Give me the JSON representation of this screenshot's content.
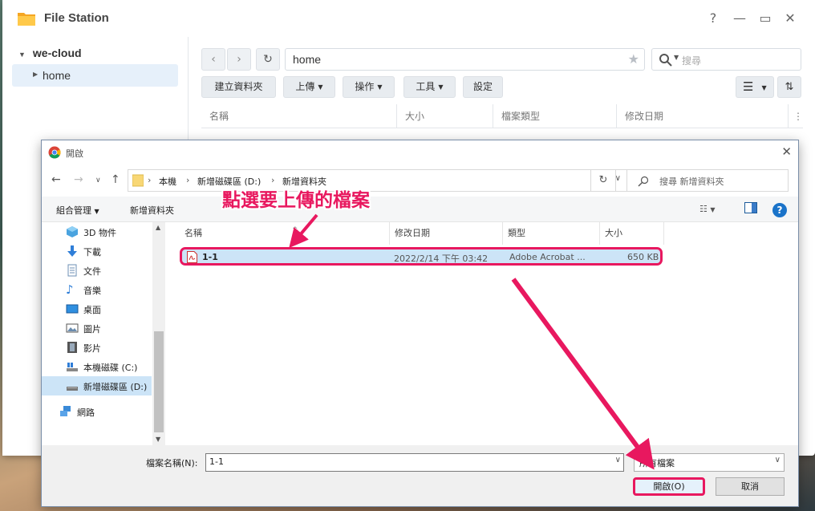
{
  "file_station": {
    "title": "File Station",
    "controls": {
      "help": "?",
      "minimize": "—",
      "maximize": "▭",
      "close": "✕"
    },
    "sidebar": {
      "root": "we-cloud",
      "child": "home"
    },
    "path": "home",
    "search_placeholder": "搜尋",
    "toolbar": {
      "create_folder": "建立資料夾",
      "upload": "上傳",
      "action": "操作",
      "tools": "工具",
      "settings": "設定"
    },
    "columns": [
      "名稱",
      "大小",
      "檔案類型",
      "修改日期"
    ]
  },
  "dialog": {
    "title": "開啟",
    "breadcrumb": [
      "本機",
      "新增磁碟區 (D:)",
      "新增資料夾"
    ],
    "search_placeholder": "搜尋 新增資料夾",
    "organize": "組合管理",
    "new_folder": "新增資料夾",
    "help": "?",
    "nav_items": [
      {
        "label": "3D 物件",
        "icon": "3d-objects-icon"
      },
      {
        "label": "下載",
        "icon": "download-icon"
      },
      {
        "label": "文件",
        "icon": "documents-icon"
      },
      {
        "label": "音樂",
        "icon": "music-icon"
      },
      {
        "label": "桌面",
        "icon": "desktop-icon"
      },
      {
        "label": "圖片",
        "icon": "pictures-icon"
      },
      {
        "label": "影片",
        "icon": "videos-icon"
      },
      {
        "label": "本機磁碟 (C:)",
        "icon": "drive-c-icon"
      },
      {
        "label": "新增磁碟區 (D:)",
        "icon": "drive-d-icon",
        "selected": true
      },
      {
        "label": "網路",
        "icon": "network-icon"
      }
    ],
    "columns": [
      "名稱",
      "修改日期",
      "類型",
      "大小"
    ],
    "files": [
      {
        "name": "1-1",
        "modified": "2022/2/14 下午 03:42",
        "type": "Adobe Acrobat ...",
        "size": "650 KB"
      }
    ],
    "filename_label": "檔案名稱(N):",
    "filename_value": "1-1",
    "filetype": "所有檔案",
    "open_button": "開啟(O)",
    "cancel_button": "取消"
  },
  "annotation": {
    "text": "點選要上傳的檔案",
    "color": "#e8185f"
  }
}
